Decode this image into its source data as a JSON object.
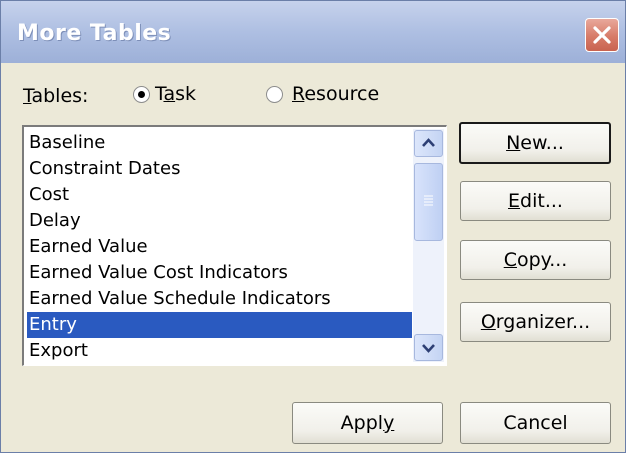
{
  "window": {
    "title": "More Tables"
  },
  "tables_label_prefix": "",
  "tables_label": {
    "first": "T",
    "rest": "ables:"
  },
  "radios": [
    {
      "first": "",
      "under": "a",
      "pre": "T",
      "post": "sk",
      "selected": true
    },
    {
      "first": "R",
      "rest": "esource",
      "selected": false
    }
  ],
  "list": {
    "items": [
      "Baseline",
      "Constraint Dates",
      "Cost",
      "Delay",
      "Earned Value",
      "Earned Value Cost Indicators",
      "Earned Value Schedule Indicators",
      "Entry",
      "Export"
    ],
    "selected": "Entry"
  },
  "buttons": {
    "new": {
      "u": "N",
      "rest": "ew..."
    },
    "edit": {
      "u": "E",
      "rest": "dit..."
    },
    "copy": {
      "u": "C",
      "rest": "opy..."
    },
    "organizer": {
      "u": "O",
      "rest": "rganizer..."
    },
    "apply": {
      "pre": "Appl",
      "u": "y"
    },
    "cancel": {
      "label": "Cancel"
    }
  },
  "colors": {
    "selection": "#2a5ac0",
    "close": "#d77b68"
  },
  "icons": {
    "close": "close-icon",
    "scroll_up": "chevron-up-icon",
    "scroll_down": "chevron-down-icon",
    "thumb": "scroll-thumb-grip"
  }
}
